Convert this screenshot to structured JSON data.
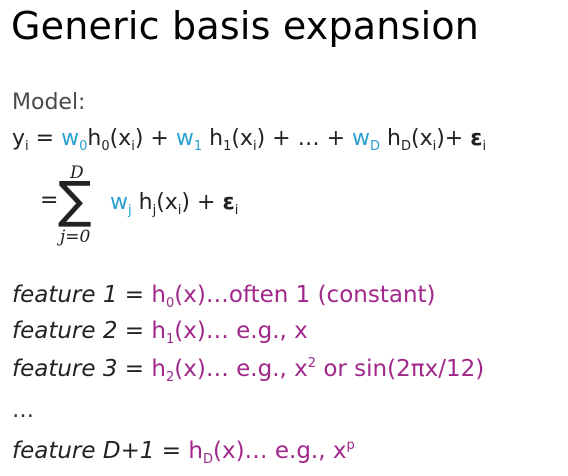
{
  "title": "Generic basis expansion",
  "model": {
    "label": "Model:",
    "eq1": {
      "y": "y",
      "y_sub": "i",
      "eq": " = ",
      "w0": "w",
      "w0_sub": "0",
      "h0": "h",
      "h0_sub": "0",
      "h0_arg_open": "(x",
      "h0_arg_sub": "i",
      "h0_arg_close": ") + ",
      "w1": "w",
      "w1_sub": "1",
      "h1": " h",
      "h1_sub": "1",
      "h1_arg_open": "(x",
      "h1_arg_sub": "i",
      "h1_arg_close": ") + … + ",
      "wD": "w",
      "wD_sub": "D",
      "hD": " h",
      "hD_sub": "D",
      "hD_arg_open": "(x",
      "hD_arg_sub": "i",
      "hD_arg_close": ")+ ",
      "eps": "ε",
      "eps_sub": "i"
    },
    "eq2": {
      "eq": "=",
      "sigma": "∑",
      "upper": "D",
      "lower": "j=0",
      "wj": "w",
      "wj_sub": "j",
      "hj": " h",
      "hj_sub": "j",
      "hj_arg_open": "(x",
      "hj_arg_sub": "i",
      "hj_arg_close": ") + ",
      "eps": "ε",
      "eps_sub": "i"
    }
  },
  "features": [
    {
      "label": "feature 1",
      "eq": " = ",
      "h": "h",
      "h_sub": "0",
      "rest": "(x)…often 1 (constant)"
    },
    {
      "label": "feature 2",
      "eq": " = ",
      "h": "h",
      "h_sub": "1",
      "rest": "(x)… e.g., x"
    },
    {
      "label": "feature 3",
      "eq": " = ",
      "h": "h",
      "h_sub": "2",
      "rest_a": "(x)… e.g., x",
      "rest_sup": "2",
      "rest_b": " or sin(2πx/12)"
    },
    {
      "label": "feature D+1",
      "eq": " = ",
      "h": "h",
      "h_sub": "D",
      "rest_a": "(x)… e.g., x",
      "rest_sup": "p"
    }
  ],
  "ellipsis": "…",
  "colors": {
    "weight": "#2a9fd0",
    "feature": "#a0288a",
    "text": "#222222"
  }
}
